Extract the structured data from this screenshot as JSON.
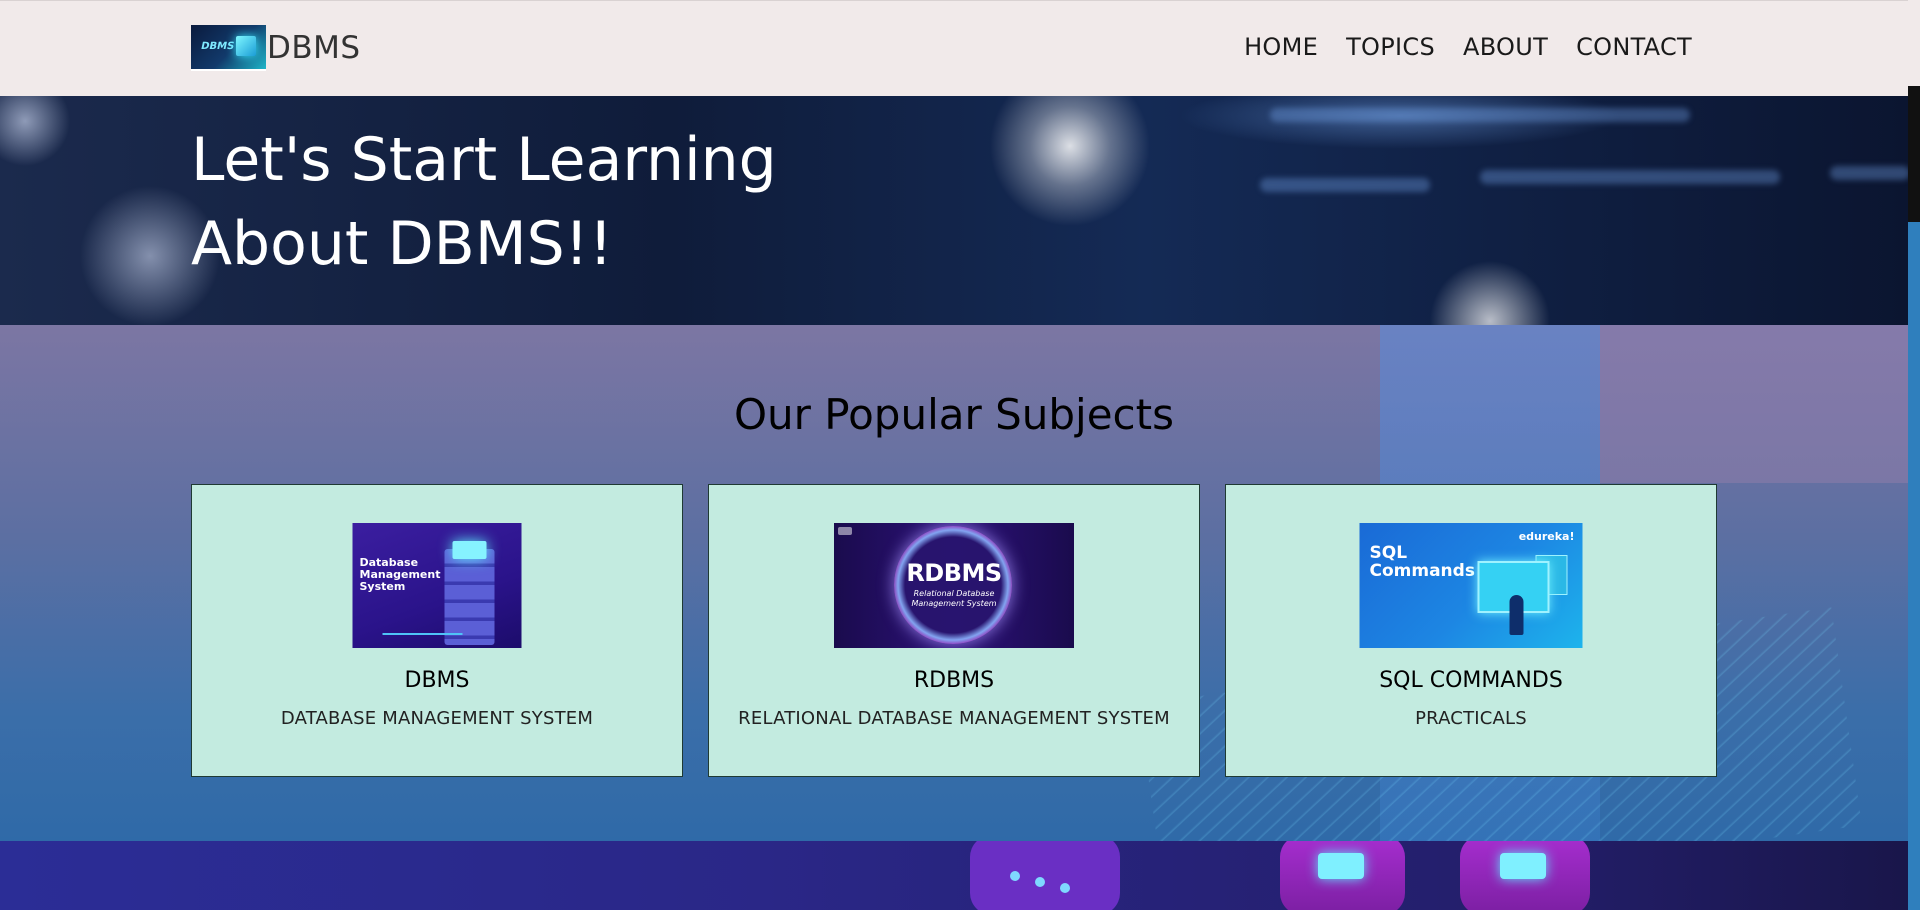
{
  "navbar": {
    "brand_name": "DBMS",
    "logo_text": "DBMS",
    "links": [
      "HOME",
      "TOPICS",
      "ABOUT",
      "CONTACT"
    ]
  },
  "hero": {
    "title_line1": "Let's Start Learning",
    "title_line2": "About DBMS!!"
  },
  "subjects": {
    "heading": "Our Popular Subjects",
    "cards": [
      {
        "name": "DBMS",
        "description": "DATABASE MANAGEMENT SYSTEM",
        "thumbnail_text": [
          "Database",
          "Management",
          "System"
        ]
      },
      {
        "name": "RDBMS",
        "description": "RELATIONAL DATABASE MANAGEMENT SYSTEM",
        "thumbnail_title": "RDBMS",
        "thumbnail_subtitle": [
          "Relational Database",
          "Management System"
        ]
      },
      {
        "name": "SQL COMMANDS",
        "description": "PRACTICALS",
        "thumbnail_title": [
          "SQL",
          "Commands"
        ],
        "thumbnail_brand": "edureka!"
      }
    ]
  },
  "colors": {
    "navbar_bg": "#f1eaea",
    "card_bg": "#c3ebe0",
    "card_border": "#1f3a33",
    "hero_text": "#ffffff"
  }
}
